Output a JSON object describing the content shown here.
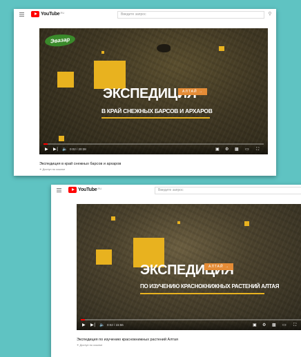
{
  "screens": [
    {
      "logo_text": "YouTube",
      "logo_sup": "RU",
      "search_placeholder": "Введите запрос",
      "brand_badge": "Эвазар",
      "headline": "ЭКСПЕДИЦИЯ",
      "tag": "АЛТАЙ →",
      "subtitle": "В КРАЙ СНЕЖНЫХ БАРСОВ И АРХАРОВ",
      "time": "0:02 / 20:38",
      "progress": 0.02,
      "video_title": "Экспедиция в край снежных барсов и архаров",
      "meta": "Доступ по ссылке"
    },
    {
      "logo_text": "YouTube",
      "logo_sup": "RU",
      "search_placeholder": "Введите запрос",
      "headline": "ЭКСПЕДИЦИЯ",
      "tag": "АЛТАЙ →",
      "subtitle": "ПО ИЗУЧЕНИЮ КРАСНОКНИЖНЫХ РАСТЕНИЙ АЛТАЯ",
      "time": "0:02 / 15:56",
      "progress": 0.02,
      "video_title": "Экспедиция по изучению краснокнижных растений Алтая",
      "meta": "Доступ по ссылке"
    }
  ],
  "colors": {
    "background": "#5fc3c2",
    "accent_yellow": "#e8b21f",
    "tag_orange": "#e58c36",
    "youtube_red": "#ff0000",
    "brand_green": "#3a8a2b"
  },
  "icons": [
    "menu-icon",
    "youtube-logo-icon",
    "search-icon",
    "play-icon",
    "next-icon",
    "volume-icon",
    "subtitles-icon",
    "settings-icon",
    "miniplayer-icon",
    "theater-icon",
    "fullscreen-icon"
  ]
}
